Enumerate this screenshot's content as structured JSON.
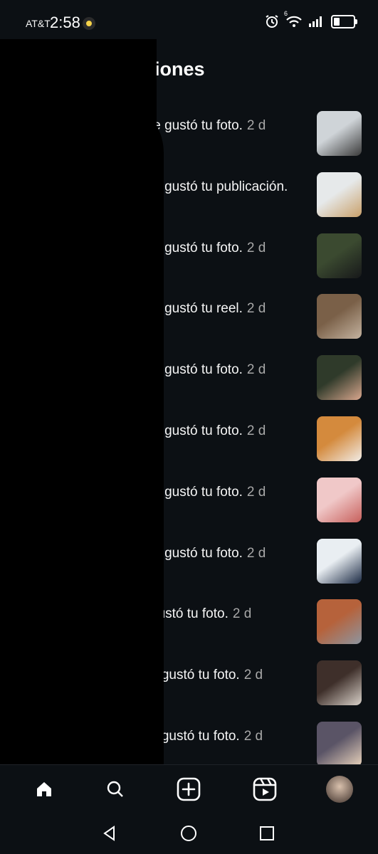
{
  "status_bar": {
    "carrier": "AT&T",
    "time": "2:58",
    "network": "6"
  },
  "header": {
    "title": "Notificaciones"
  },
  "notifications": [
    {
      "text": "le gustó tu foto.",
      "time": "2 d",
      "thumb_colors": [
        "#cfd4d8",
        "#3a3a3a"
      ]
    },
    {
      "text": "le gustó tu publicación.",
      "time": "",
      "thumb_colors": [
        "#e6e9ea",
        "#c9a06a"
      ]
    },
    {
      "text": "le gustó tu foto.",
      "time": "2 d",
      "thumb_colors": [
        "#3b4a30",
        "#17181a"
      ]
    },
    {
      "text": "le gustó tu reel.",
      "time": "2 d",
      "thumb_colors": [
        "#7a6048",
        "#c4b3a0"
      ]
    },
    {
      "text": "le gustó tu foto.",
      "time": "2 d",
      "thumb_colors": [
        "#2f3a2a",
        "#d9a78e"
      ]
    },
    {
      "text": "le gustó tu foto.",
      "time": "2 d",
      "thumb_colors": [
        "#d48a3d",
        "#f1ece6"
      ]
    },
    {
      "text": "le gustó tu foto.",
      "time": "2 d",
      "thumb_colors": [
        "#f0c8c8",
        "#c7605c"
      ]
    },
    {
      "text": "le gustó tu foto.",
      "time": "2 d",
      "thumb_colors": [
        "#e9eef2",
        "#1b2a44"
      ]
    },
    {
      "text": "gustó tu foto.",
      "time": "2 d",
      "thumb_colors": [
        "#b6623b",
        "#8d95a0"
      ]
    },
    {
      "text": "e gustó tu foto.",
      "time": "2 d",
      "thumb_colors": [
        "#3e2f2a",
        "#d9d1c9"
      ]
    },
    {
      "text": "e gustó tu foto.",
      "time": "2 d",
      "thumb_colors": [
        "#5a5466",
        "#e9d3bc"
      ]
    }
  ],
  "tabbar": {
    "items": [
      "home-icon",
      "search-icon",
      "new-post-icon",
      "reels-icon",
      "profile-avatar"
    ]
  },
  "colors": {
    "background": "#0c1014",
    "text": "#f5f5f5",
    "muted": "#a8a8a8"
  }
}
